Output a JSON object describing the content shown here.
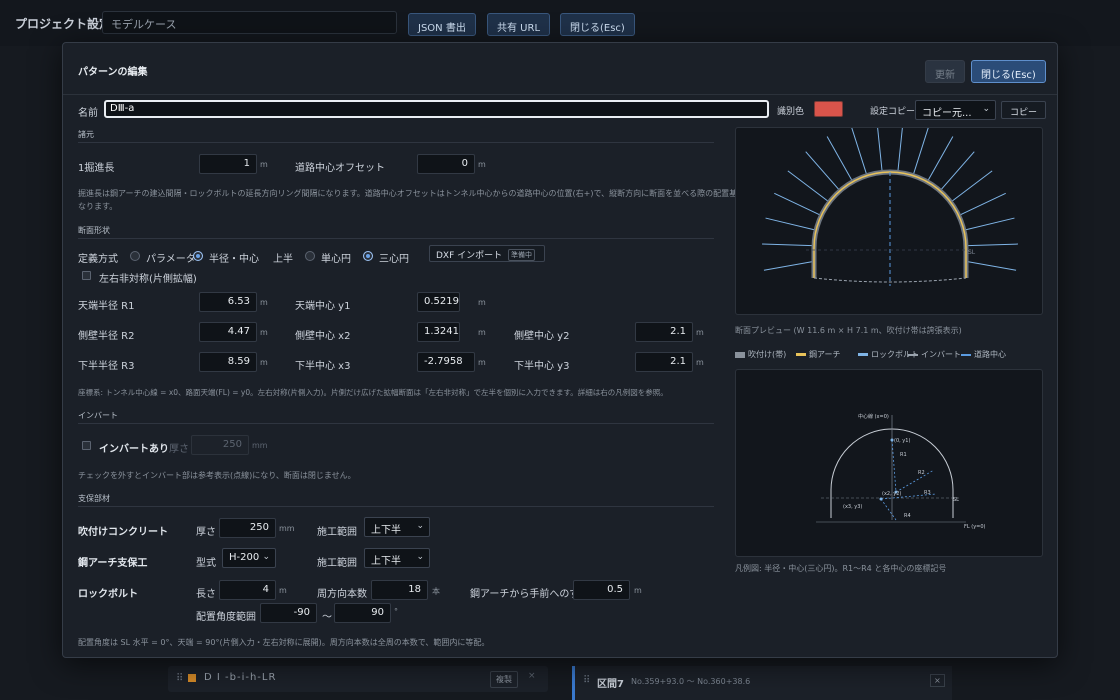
{
  "app": {
    "title": "プロジェクト設定",
    "project_name": "モデルケース",
    "btn_json": "JSON 書出",
    "btn_share": "共有 URL",
    "btn_close": "閉じる(Esc)"
  },
  "background": {
    "row1_name": "D I -b-i-h-LR",
    "row1_dup": "複製",
    "row1_close": "×",
    "row2_name": "区間7",
    "row2_range": "No.359+93.0 〜 No.360+38.6",
    "row2_close": "×"
  },
  "modal": {
    "title": "パターンの編集",
    "btn_update": "更新",
    "btn_close": "閉じる(Esc)",
    "name_label": "名前",
    "name_value": "DⅢ-a",
    "color_label": "識別色",
    "color_value": "#d9544b",
    "copy_label": "設定コピー",
    "copy_select": "コピー元...",
    "copy_button": "コピー"
  },
  "shoshin": {
    "section": "諸元",
    "advance_label": "1掘進長",
    "advance_value": "1",
    "advance_unit": "m",
    "offset_label": "道路中心オフセット",
    "offset_value": "0",
    "offset_unit": "m",
    "note_1": "掘進長は鋼アーチの建込間隔・ロックボルトの延長方向リング間隔になります。道路中心オフセットはトンネル中心からの道路中心の位置(右+)で、縦断方向に断面を並べる際の配置基準に",
    "note_2": "なります。"
  },
  "shape": {
    "section": "断面形状",
    "def_label": "定義方式",
    "opt_param": "パラメータ",
    "opt_radius": "半径・中心",
    "upper_label": "上半",
    "opt_single": "単心円",
    "opt_three": "三心円",
    "dxf_label": "DXF インポート",
    "dxf_badge": "準備中",
    "asym_label": "左右非対称(片側拡幅)",
    "r1_label": "天端半径 R1",
    "r1_value": "6.53",
    "r1_unit": "m",
    "y1_label": "天端中心 y1",
    "y1_value": "0.52195",
    "y1_unit": "m",
    "r2_label": "側壁半径 R2",
    "r2_value": "4.47",
    "r2_unit": "m",
    "x2_label": "側壁中心 x2",
    "x2_value": "1.32414",
    "x2_unit": "m",
    "y2_label": "側壁中心 y2",
    "y2_value": "2.1",
    "y2_unit": "m",
    "r3_label": "下半半径 R3",
    "r3_value": "8.59",
    "r3_unit": "m",
    "x3_label": "下半中心 x3",
    "x3_value": "-2.7958",
    "x3_unit": "m",
    "y3_label": "下半中心 y3",
    "y3_value": "2.1",
    "y3_unit": "m",
    "note": "座標系: トンネル中心線 = x0、路面天端(FL) = y0。左右対称(片側入力)。片側だけ広げた拡幅断面は「左右非対称」で左半を個別に入力できます。詳細は右の凡例図を参照。"
  },
  "invert": {
    "section": "インバート",
    "check_label": "インバートあり",
    "thickness_label": "厚さ",
    "thickness_value": "250",
    "thickness_unit": "mm",
    "note": "チェックを外すとインバート部は参考表示(点線)になり、断面は閉じません。"
  },
  "support": {
    "section": "支保部材",
    "shot_label": "吹付けコンクリート",
    "shot_thick_label": "厚さ",
    "shot_thick_value": "250",
    "shot_thick_unit": "mm",
    "shot_range_label": "施工範囲",
    "shot_range_value": "上下半",
    "arch_label": "鋼アーチ支保工",
    "arch_type_label": "型式",
    "arch_type_value": "H-200",
    "arch_range_label": "施工範囲",
    "arch_range_value": "上下半",
    "bolt_label": "ロックボルト",
    "bolt_len_label": "長さ",
    "bolt_len_value": "4",
    "bolt_len_unit": "m",
    "bolt_count_label": "周方向本数",
    "bolt_count_value": "18",
    "bolt_count_unit": "本",
    "bolt_shift_label": "鋼アーチから手前へのずれ",
    "bolt_shift_value": "0.5",
    "bolt_shift_unit": "m",
    "angle_label": "配置角度範囲",
    "angle_from": "-90",
    "angle_sep": "〜",
    "angle_to": "90",
    "angle_unit": "°",
    "note": "配置角度は SL 水平 = 0°、天端 = 90°(片側入力・左右対称に展開)。周方向本数は全周の本数で、範囲内に等配。"
  },
  "preview": {
    "caption": "断面プレビュー (W 11.6 m × H 7.1 m、吹付け帯は誇張表示)",
    "sl_label": "SL",
    "legend": [
      {
        "label": "吹付け(帯)",
        "color": "#8a929c"
      },
      {
        "label": "鋼アーチ",
        "color": "#e8c25a"
      },
      {
        "label": "ロックボルト",
        "color": "#7fb4e6"
      },
      {
        "label": "インバート",
        "color": "#9aa3ae"
      },
      {
        "label": "道路中心",
        "color": "#5b9be0"
      }
    ],
    "diagram_caption": "凡例図: 半径・中心(三心円)。R1〜R4 と各中心の座標記号",
    "diagram_labels": {
      "center": "中心線 (x=0)",
      "c1": "(0, y1)",
      "r1": "R1",
      "r2": "R2",
      "c2": "(x2, y2)",
      "r3": "R3",
      "c3": "(x3, y3)",
      "r4": "R4",
      "sl": "SL",
      "fl": "FL (y=0)"
    }
  },
  "colors": {
    "accent": "#3a7ad0",
    "arch": "#e8c25a",
    "bolt": "#7fb4e6",
    "name_swatch": "#d9544b"
  }
}
